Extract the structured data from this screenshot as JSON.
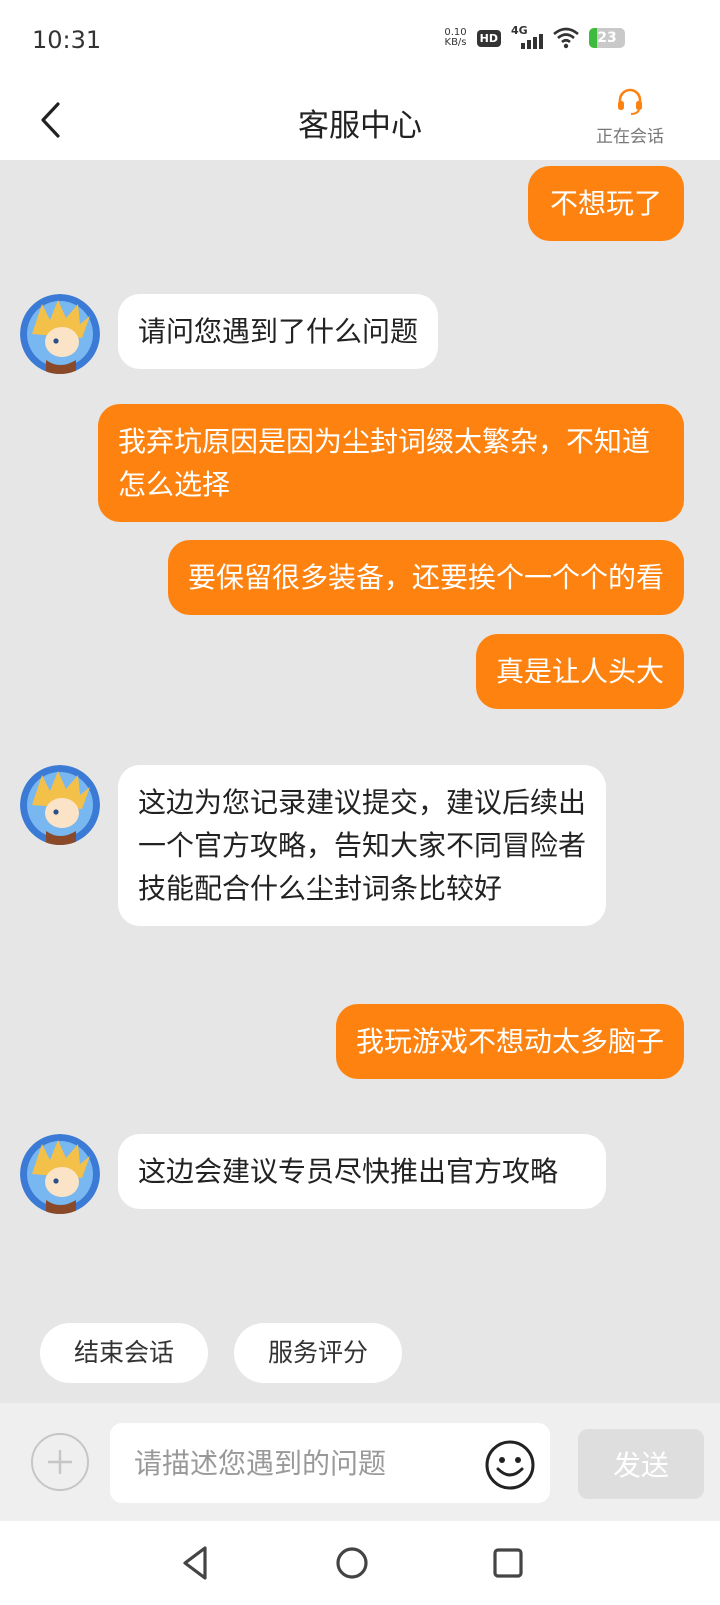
{
  "status_bar": {
    "time": "10:31",
    "net_speed_value": "0.10",
    "net_speed_unit": "KB/s",
    "hd_label": "HD",
    "network_label": "4G",
    "battery_percent": "23",
    "battery_level": 0.23
  },
  "header": {
    "title": "客服中心",
    "session_label": "正在会话",
    "back_icon": "chevron-left-icon",
    "session_icon": "headset-icon"
  },
  "messages": [
    {
      "from": "user",
      "text": "不想玩了"
    },
    {
      "from": "agent",
      "text": "请问您遇到了什么问题"
    },
    {
      "from": "user",
      "text": "我弃坑原因是因为尘封词缀太繁杂，不知道怎么选择"
    },
    {
      "from": "user",
      "text": "要保留很多装备，还要挨个一个个的看"
    },
    {
      "from": "user",
      "text": "真是让人头大"
    },
    {
      "from": "agent",
      "text": "这边为您记录建议提交，建议后续出一个官方攻略，告知大家不同冒险者技能配合什么尘封词条比较好"
    },
    {
      "from": "user",
      "text": "我玩游戏不想动太多脑子"
    },
    {
      "from": "agent",
      "text": "这边会建议专员尽快推出官方攻略"
    }
  ],
  "quick_actions": [
    "结束会话",
    "服务评分"
  ],
  "composer": {
    "placeholder": "请描述您遇到的问题",
    "send_label": "发送",
    "plus_icon": "plus-icon",
    "emoji_icon": "smiley-icon"
  },
  "colors": {
    "accent": "#fd820f",
    "chat_bg": "#e6e6e6",
    "agent_bubble": "#ffffff"
  }
}
